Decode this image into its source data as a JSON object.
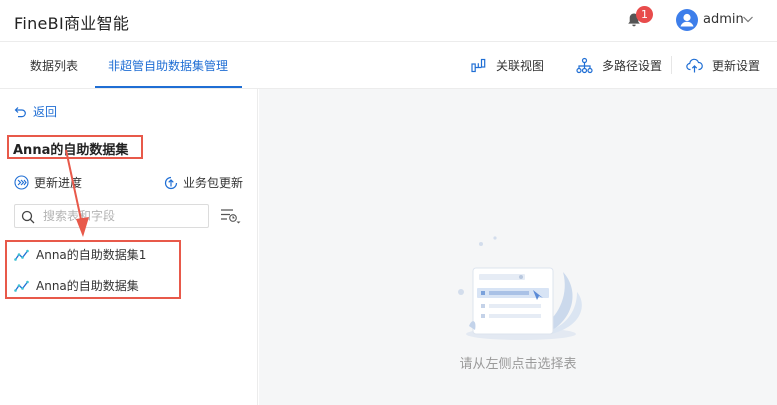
{
  "header": {
    "app_title": "FineBI商业智能",
    "notification_count": "1",
    "user_name": "admin"
  },
  "tabs": [
    {
      "label": "数据列表",
      "active": false
    },
    {
      "label": "非超管自助数据集管理",
      "active": true
    }
  ],
  "toolbar": {
    "relation_view": "关联视图",
    "multipath_settings": "多路径设置",
    "update_settings": "更新设置"
  },
  "left_panel": {
    "back_label": "返回",
    "dataset_title": "Anna的自助数据集",
    "update_progress": "更新进度",
    "package_update": "业务包更新",
    "search_placeholder": "搜索表和字段",
    "items": [
      {
        "label": "Anna的自助数据集1"
      },
      {
        "label": "Anna的自助数据集"
      }
    ]
  },
  "right_panel": {
    "empty_hint": "请从左侧点击选择表"
  },
  "colors": {
    "accent": "#1f6ed4",
    "annotation": "#e8594a",
    "badge": "#e84c4c"
  }
}
